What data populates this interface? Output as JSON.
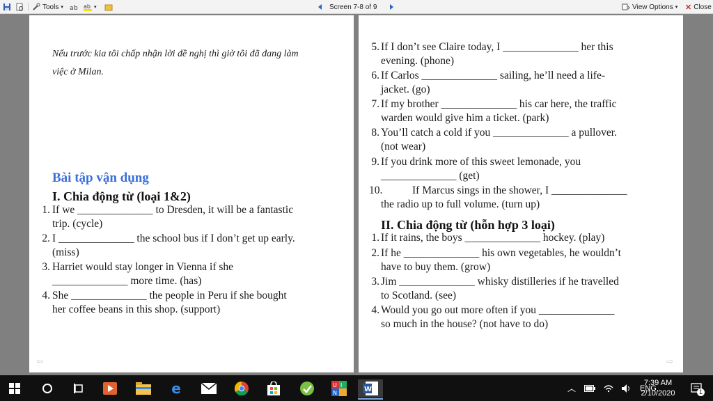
{
  "toolbar": {
    "tools_label": "Tools",
    "screen_label": "Screen 7-8 of 9",
    "view_options_label": "View Options",
    "close_label": "Close"
  },
  "left_page": {
    "vn_line1": "Nếu trước kia tôi chấp nhận lời đề nghị thì giờ tôi đã đang làm",
    "vn_line2": "việc ở Milan.",
    "heading_blue": "Bài tập vận dụng",
    "section_title": "I. Chia động từ (loại 1&2)",
    "items": [
      {
        "num": "1.",
        "l1": "If we ______________ to Dresden, it will be a fantastic",
        "l2": "trip. (cycle)"
      },
      {
        "num": "2.",
        "l1": "I ______________ the school bus if I don’t get up early.",
        "l2": "(miss)"
      },
      {
        "num": "3.",
        "l1": "Harriet would stay longer in Vienna if she",
        "l2": "______________ more time. (has)"
      },
      {
        "num": "4.",
        "l1": "She ______________ the people in Peru if she bought",
        "l2": "her coffee beans in this shop. (support)"
      }
    ]
  },
  "right_page": {
    "items": [
      {
        "num": "5.",
        "l1": "If I don’t see Claire today, I ______________ her this",
        "l2": "evening. (phone)"
      },
      {
        "num": "6.",
        "l1": "If Carlos ______________ sailing, he’ll need a life-",
        "l2": "jacket. (go)"
      },
      {
        "num": "7.",
        "l1": "If my brother ______________ his car here, the traffic",
        "l2": "warden would give him a ticket. (park)"
      },
      {
        "num": "8.",
        "l1": "You’ll catch a cold if you ______________ a pullover.",
        "l2": "(not wear)"
      },
      {
        "num": "9.",
        "l1": "If you drink more of this sweet lemonade, you",
        "l2": "______________ (get)"
      },
      {
        "num": "10.",
        "l1": "If Marcus sings in the shower, I ______________",
        "l2": "the radio up to full volume. (turn up)"
      }
    ],
    "section_title": "II. Chia động từ (hỗn hợp 3 loại)",
    "items2": [
      {
        "num": "1.",
        "l1": "If it rains, the boys ______________ hockey. (play)",
        "l2": ""
      },
      {
        "num": "2.",
        "l1": "If he ______________ his own vegetables, he wouldn’t",
        "l2": "have to buy them. (grow)"
      },
      {
        "num": "3.",
        "l1": "Jim ______________ whisky distilleries if he travelled",
        "l2": "to Scotland. (see)"
      },
      {
        "num": "4.",
        "l1": "Would you go out more often if you ______________",
        "l2": "so much in the house? (not have to do)"
      }
    ]
  },
  "taskbar": {
    "lang": "ENG",
    "time": "7:39 AM",
    "date": "2/10/2020",
    "notification_count": "1"
  },
  "colors": {
    "accent_blue": "#3a6fd8",
    "taskbar": "#101010",
    "background": "#808080"
  }
}
